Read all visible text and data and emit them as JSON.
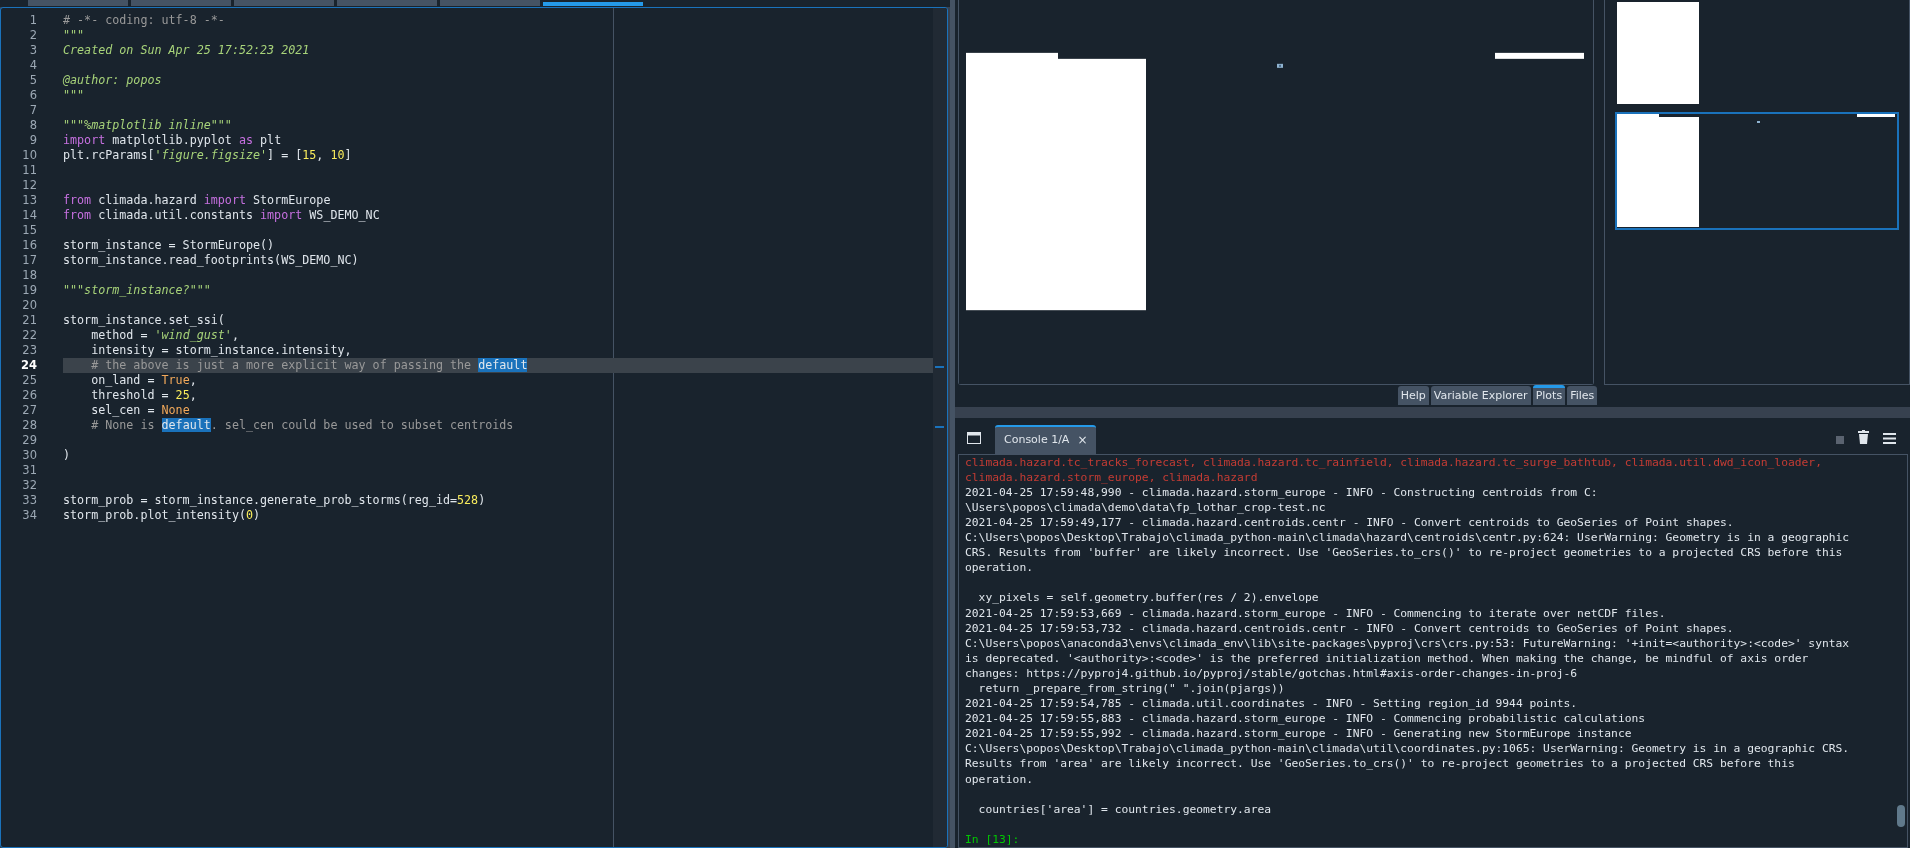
{
  "editor": {
    "tabs": [
      {
        "selected": false
      },
      {
        "selected": false
      },
      {
        "selected": false
      },
      {
        "selected": false
      },
      {
        "selected": false
      },
      {
        "selected": true
      }
    ],
    "lines": [
      {
        "number": "1",
        "current": false,
        "tokens": [
          {
            "kind": "comment",
            "text": "# -*- coding: utf-8 -*-"
          }
        ]
      },
      {
        "number": "2",
        "current": false,
        "tokens": [
          {
            "kind": "docstring",
            "text": "\"\"\""
          }
        ]
      },
      {
        "number": "3",
        "current": false,
        "tokens": [
          {
            "kind": "docstring",
            "text": "Created on Sun Apr 25 17:52:23 2021"
          }
        ]
      },
      {
        "number": "4",
        "current": false
      },
      {
        "number": "5",
        "current": false,
        "tokens": [
          {
            "kind": "docstring",
            "text": "@author: popos"
          }
        ]
      },
      {
        "number": "6",
        "current": false,
        "tokens": [
          {
            "kind": "docstring",
            "text": "\"\"\""
          }
        ]
      },
      {
        "number": "7",
        "current": false
      },
      {
        "number": "8",
        "current": false,
        "tokens": [
          {
            "kind": "docstring",
            "text": "\"\"\"%matplotlib inline\"\"\""
          }
        ]
      },
      {
        "number": "9",
        "current": false,
        "tokens": [
          {
            "kind": "keyword",
            "text": "import"
          },
          {
            "kind": "plain",
            "text": " matplotlib.pyplot "
          },
          {
            "kind": "keyword",
            "text": "as"
          },
          {
            "kind": "plain",
            "text": " plt"
          }
        ]
      },
      {
        "number": "10",
        "current": false,
        "tokens": [
          {
            "kind": "plain",
            "text": "plt.rcParams["
          },
          {
            "kind": "string",
            "text": "'figure.figsize'"
          },
          {
            "kind": "plain",
            "text": "] = ["
          },
          {
            "kind": "number",
            "text": "15"
          },
          {
            "kind": "plain",
            "text": ", "
          },
          {
            "kind": "number",
            "text": "10"
          },
          {
            "kind": "plain",
            "text": "]"
          }
        ]
      },
      {
        "number": "11",
        "current": false
      },
      {
        "number": "12",
        "current": false
      },
      {
        "number": "13",
        "current": false,
        "tokens": [
          {
            "kind": "keyword",
            "text": "from"
          },
          {
            "kind": "plain",
            "text": " climada.hazard "
          },
          {
            "kind": "keyword",
            "text": "import"
          },
          {
            "kind": "plain",
            "text": " StormEurope"
          }
        ]
      },
      {
        "number": "14",
        "current": false,
        "tokens": [
          {
            "kind": "keyword",
            "text": "from"
          },
          {
            "kind": "plain",
            "text": " climada.util.constants "
          },
          {
            "kind": "keyword",
            "text": "import"
          },
          {
            "kind": "plain",
            "text": " WS_DEMO_NC"
          }
        ]
      },
      {
        "number": "15",
        "current": false
      },
      {
        "number": "16",
        "current": false,
        "tokens": [
          {
            "kind": "plain",
            "text": "storm_instance = StormEurope()"
          }
        ]
      },
      {
        "number": "17",
        "current": false,
        "tokens": [
          {
            "kind": "plain",
            "text": "storm_instance.read_footprints(WS_DEMO_NC)"
          }
        ]
      },
      {
        "number": "18",
        "current": false
      },
      {
        "number": "19",
        "current": false,
        "tokens": [
          {
            "kind": "docstring",
            "text": "\"\"\"storm_instance?\"\"\""
          }
        ]
      },
      {
        "number": "20",
        "current": false
      },
      {
        "number": "21",
        "current": false,
        "tokens": [
          {
            "kind": "plain",
            "text": "storm_instance.set_ssi("
          }
        ]
      },
      {
        "number": "22",
        "current": false,
        "tokens": [
          {
            "kind": "plain",
            "text": "    method = "
          },
          {
            "kind": "string",
            "text": "'wind_gust'"
          },
          {
            "kind": "plain",
            "text": ","
          }
        ]
      },
      {
        "number": "23",
        "current": false,
        "tokens": [
          {
            "kind": "plain",
            "text": "    intensity = storm_instance.intensity,"
          }
        ]
      },
      {
        "number": "24",
        "current": true,
        "tokens": [
          {
            "kind": "comment",
            "text": "    # the above is just a more explicit way of passing the "
          },
          {
            "kind": "match",
            "text": "default"
          }
        ]
      },
      {
        "number": "25",
        "current": false,
        "tokens": [
          {
            "kind": "plain",
            "text": "    on_land = "
          },
          {
            "kind": "constant",
            "text": "True"
          },
          {
            "kind": "plain",
            "text": ","
          }
        ]
      },
      {
        "number": "26",
        "current": false,
        "tokens": [
          {
            "kind": "plain",
            "text": "    threshold = "
          },
          {
            "kind": "number",
            "text": "25"
          },
          {
            "kind": "plain",
            "text": ","
          }
        ]
      },
      {
        "number": "27",
        "current": false,
        "tokens": [
          {
            "kind": "plain",
            "text": "    sel_cen = "
          },
          {
            "kind": "constant",
            "text": "None"
          }
        ]
      },
      {
        "number": "28",
        "current": false,
        "tokens": [
          {
            "kind": "comment",
            "text": "    # None is "
          },
          {
            "kind": "match",
            "text": "default"
          },
          {
            "kind": "comment",
            "text": ". sel_cen could be used to subset centroids"
          }
        ]
      },
      {
        "number": "29",
        "current": false
      },
      {
        "number": "30",
        "current": false,
        "tokens": [
          {
            "kind": "plain",
            "text": ")"
          }
        ]
      },
      {
        "number": "31",
        "current": false
      },
      {
        "number": "32",
        "current": false
      },
      {
        "number": "33",
        "current": false,
        "tokens": [
          {
            "kind": "plain",
            "text": "storm_prob = storm_instance.generate_prob_storms(reg_id="
          },
          {
            "kind": "number",
            "text": "528"
          },
          {
            "kind": "plain",
            "text": ")"
          }
        ]
      },
      {
        "number": "34",
        "current": false,
        "tokens": [
          {
            "kind": "plain",
            "text": "storm_prob.plot_intensity("
          },
          {
            "kind": "number",
            "text": "0"
          },
          {
            "kind": "plain",
            "text": ")"
          }
        ]
      }
    ]
  },
  "plots": {
    "thumbnails": [
      {
        "selected": false
      },
      {
        "selected": true
      }
    ],
    "tabs": [
      {
        "label": "Help",
        "selected": false
      },
      {
        "label": "Variable Explorer",
        "selected": false
      },
      {
        "label": "Plots",
        "selected": true
      },
      {
        "label": "Files",
        "selected": false
      }
    ]
  },
  "console": {
    "tabs": [
      {
        "label": "Console 1/A",
        "close": "×",
        "selected": true
      }
    ],
    "lines": [
      {
        "kind": "error",
        "text": "climada.hazard.tc_tracks_forecast, climada.hazard.tc_rainfield, climada.hazard.tc_surge_bathtub, climada.util.dwd_icon_loader,"
      },
      {
        "kind": "error",
        "text": "climada.hazard.storm_europe, climada.hazard"
      },
      {
        "kind": "output",
        "text": "2021-04-25 17:59:48,990 - climada.hazard.storm_europe - INFO - Constructing centroids from C:"
      },
      {
        "kind": "output",
        "text": "\\Users\\popos\\climada\\demo\\data\\fp_lothar_crop-test.nc"
      },
      {
        "kind": "output",
        "text": "2021-04-25 17:59:49,177 - climada.hazard.centroids.centr - INFO - Convert centroids to GeoSeries of Point shapes."
      },
      {
        "kind": "output",
        "text": "C:\\Users\\popos\\Desktop\\Trabajo\\climada_python-main\\climada\\hazard\\centroids\\centr.py:624: UserWarning: Geometry is in a geographic"
      },
      {
        "kind": "output",
        "text": "CRS. Results from 'buffer' are likely incorrect. Use 'GeoSeries.to_crs()' to re-project geometries to a projected CRS before this"
      },
      {
        "kind": "output",
        "text": "operation."
      },
      {
        "kind": "blank"
      },
      {
        "kind": "output",
        "text": "  xy_pixels = self.geometry.buffer(res / 2).envelope"
      },
      {
        "kind": "output",
        "text": "2021-04-25 17:59:53,669 - climada.hazard.storm_europe - INFO - Commencing to iterate over netCDF files."
      },
      {
        "kind": "output",
        "text": "2021-04-25 17:59:53,732 - climada.hazard.centroids.centr - INFO - Convert centroids to GeoSeries of Point shapes."
      },
      {
        "kind": "output",
        "text": "C:\\Users\\popos\\anaconda3\\envs\\climada_env\\lib\\site-packages\\pyproj\\crs\\crs.py:53: FutureWarning: '+init=<authority>:<code>' syntax"
      },
      {
        "kind": "output",
        "text": "is deprecated. '<authority>:<code>' is the preferred initialization method. When making the change, be mindful of axis order"
      },
      {
        "kind": "output",
        "text": "changes: https://pyproj4.github.io/pyproj/stable/gotchas.html#axis-order-changes-in-proj-6"
      },
      {
        "kind": "output",
        "text": "  return _prepare_from_string(\" \".join(pjargs))"
      },
      {
        "kind": "output",
        "text": "2021-04-25 17:59:54,785 - climada.util.coordinates - INFO - Setting region_id 9944 points."
      },
      {
        "kind": "output",
        "text": "2021-04-25 17:59:55,883 - climada.hazard.storm_europe - INFO - Commencing probabilistic calculations"
      },
      {
        "kind": "output",
        "text": "2021-04-25 17:59:55,992 - climada.hazard.storm_europe - INFO - Generating new StormEurope instance"
      },
      {
        "kind": "output",
        "text": "C:\\Users\\popos\\Desktop\\Trabajo\\climada_python-main\\climada\\util\\coordinates.py:1065: UserWarning: Geometry is in a geographic CRS."
      },
      {
        "kind": "output",
        "text": "Results from 'area' are likely incorrect. Use 'GeoSeries.to_crs()' to re-project geometries to a projected CRS before this"
      },
      {
        "kind": "output",
        "text": "operation."
      },
      {
        "kind": "blank"
      },
      {
        "kind": "output",
        "text": "  countries['area'] = countries.geometry.area"
      },
      {
        "kind": "blank"
      },
      {
        "kind": "prompt",
        "text": "In [13]:"
      }
    ]
  }
}
